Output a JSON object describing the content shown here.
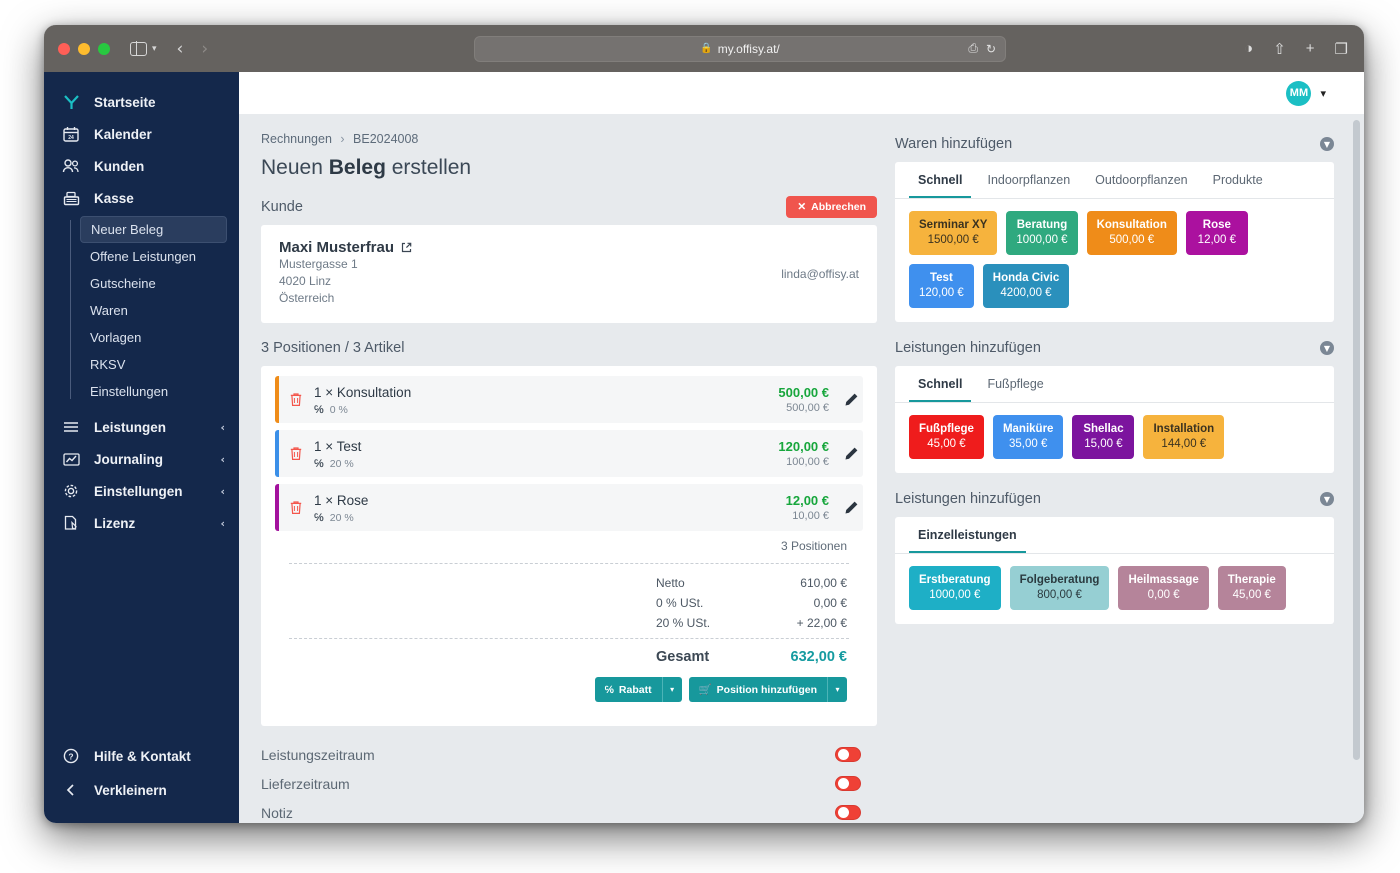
{
  "browser": {
    "url": "my.offisy.at/",
    "lock_icon": "lock-icon",
    "reload_icon": "reload-icon",
    "translate_icon": "translate-icon",
    "back_icon": "chevron-left-icon",
    "forward_icon": "chevron-right-icon",
    "sidebar_icon": "sidebar-toggle-icon",
    "download_icon": "download-icon",
    "share_icon": "share-icon",
    "newtab_icon": "plus-icon",
    "tabs_icon": "tab-overview-icon"
  },
  "sidebar": {
    "items": [
      {
        "label": "Startseite",
        "icon": "logo-y-icon",
        "caret": ""
      },
      {
        "label": "Kalender",
        "icon": "calendar-icon",
        "caret": ""
      },
      {
        "label": "Kunden",
        "icon": "users-icon",
        "caret": ""
      },
      {
        "label": "Kasse",
        "icon": "cash-register-icon",
        "caret": "ⱟ"
      },
      {
        "label": "Leistungen",
        "icon": "list-icon",
        "caret": "‹"
      },
      {
        "label": "Journaling",
        "icon": "chart-icon",
        "caret": "‹"
      },
      {
        "label": "Einstellungen",
        "icon": "gear-icon",
        "caret": "‹"
      },
      {
        "label": "Lizenz",
        "icon": "license-icon",
        "caret": "‹"
      }
    ],
    "submenu": [
      {
        "label": "Neuer Beleg",
        "active": true
      },
      {
        "label": "Offene Leistungen",
        "active": false
      },
      {
        "label": "Gutscheine",
        "active": false
      },
      {
        "label": "Waren",
        "active": false
      },
      {
        "label": "Vorlagen",
        "active": false
      },
      {
        "label": "RKSV",
        "active": false
      },
      {
        "label": "Einstellungen",
        "active": false
      }
    ],
    "bottom": [
      {
        "label": "Hilfe & Kontakt",
        "icon": "help-icon"
      },
      {
        "label": "Verkleinern",
        "icon": "chevron-left-icon"
      }
    ]
  },
  "topbar": {
    "avatar_initials": "MM",
    "caret": "ⱟ"
  },
  "breadcrumb": {
    "root": "Rechnungen",
    "separator": "›",
    "current": "BE2024008"
  },
  "page": {
    "title_pre": "Neuen ",
    "title_bold": "Beleg",
    "title_post": " erstellen"
  },
  "customer_section": {
    "heading": "Kunde",
    "cancel_label": "Abbrechen",
    "cancel_icon": "close-icon",
    "name": "Maxi Musterfrau",
    "external_icon": "external-link-icon",
    "street": "Mustergasse 1",
    "city": "4020 Linz",
    "country": "Österreich",
    "email": "linda@offisy.at"
  },
  "positions_section": {
    "heading": "3 Positionen / 3 Artikel",
    "rows": [
      {
        "qty_title": "1 × Konsultation",
        "tax": "0 %",
        "gross": "500,00 €",
        "net": "500,00 €",
        "bar": "#ef8c19"
      },
      {
        "qty_title": "1 × Test",
        "tax": "20 %",
        "gross": "120,00 €",
        "net": "100,00 €",
        "bar": "#3b8fe8"
      },
      {
        "qty_title": "1 × Rose",
        "tax": "20 %",
        "gross": "12,00 €",
        "net": "10,00 €",
        "bar": "#a3119d"
      }
    ],
    "count_label": "3 Positionen",
    "totals": [
      {
        "label": "Netto",
        "value": "610,00 €"
      },
      {
        "label": "0 % USt.",
        "value": "0,00 €"
      },
      {
        "label": "20 % USt.",
        "value": "+ 22,00 €"
      }
    ],
    "grand_label": "Gesamt",
    "grand_value": "632,00 €",
    "discount_label": "Rabatt",
    "discount_icon": "percent-icon",
    "add_position_label": "Position hinzufügen",
    "add_position_icon": "cart-icon",
    "split_caret": "▾"
  },
  "toggles": [
    {
      "label": "Leistungszeitraum",
      "on": false
    },
    {
      "label": "Lieferzeitraum",
      "on": false
    },
    {
      "label": "Notiz",
      "on": false
    }
  ],
  "panels": [
    {
      "title": "Waren hinzufügen",
      "collapse_icon": "chevron-down-circle-icon",
      "tabs": [
        {
          "label": "Schnell",
          "active": true
        },
        {
          "label": "Indoorpflanzen",
          "active": false
        },
        {
          "label": "Outdoorpflanzen",
          "active": false
        },
        {
          "label": "Produkte",
          "active": false
        }
      ],
      "tiles": [
        {
          "name": "Serminar XY",
          "price": "1500,00 €",
          "bg": "#f6b33d",
          "fg": "#3a3220"
        },
        {
          "name": "Beratung",
          "price": "1000,00 €",
          "bg": "#2fa97f",
          "fg": "#ffffff"
        },
        {
          "name": "Konsultation",
          "price": "500,00 €",
          "bg": "#ef8c19",
          "fg": "#ffffff"
        },
        {
          "name": "Rose",
          "price": "12,00 €",
          "bg": "#ab119f",
          "fg": "#ffffff"
        },
        {
          "name": "Test",
          "price": "120,00 €",
          "bg": "#3f90ee",
          "fg": "#ffffff"
        },
        {
          "name": "Honda Civic",
          "price": "4200,00 €",
          "bg": "#2a90bc",
          "fg": "#ffffff"
        }
      ]
    },
    {
      "title": "Leistungen hinzufügen",
      "collapse_icon": "chevron-down-circle-icon",
      "tabs": [
        {
          "label": "Schnell",
          "active": true
        },
        {
          "label": "Fußpflege",
          "active": false
        }
      ],
      "tiles": [
        {
          "name": "Fußpflege",
          "price": "45,00 €",
          "bg": "#ef1c1c",
          "fg": "#ffffff"
        },
        {
          "name": "Maniküre",
          "price": "35,00 €",
          "bg": "#3f90ee",
          "fg": "#ffffff"
        },
        {
          "name": "Shellac",
          "price": "15,00 €",
          "bg": "#7c149e",
          "fg": "#ffffff"
        },
        {
          "name": "Installation",
          "price": "144,00 €",
          "bg": "#f6b33d",
          "fg": "#3a3220"
        }
      ]
    },
    {
      "title": "Leistungen hinzufügen",
      "collapse_icon": "chevron-down-circle-icon",
      "tabs": [
        {
          "label": "Einzelleistungen",
          "active": true
        }
      ],
      "tiles": [
        {
          "name": "Erstberatung",
          "price": "1000,00 €",
          "bg": "#1eafc6",
          "fg": "#ffffff"
        },
        {
          "name": "Folgeberatung",
          "price": "800,00 €",
          "bg": "#96cfd3",
          "fg": "#2b3b40"
        },
        {
          "name": "Heilmassage",
          "price": "0,00 €",
          "bg": "#b5849a",
          "fg": "#ffffff"
        },
        {
          "name": "Therapie",
          "price": "45,00 €",
          "bg": "#b5849a",
          "fg": "#ffffff"
        }
      ]
    }
  ],
  "colors": {
    "sidebar_bg": "#14284b",
    "accent_teal": "#17989c",
    "danger": "#ef4136",
    "page_bg": "#e7eaed"
  }
}
